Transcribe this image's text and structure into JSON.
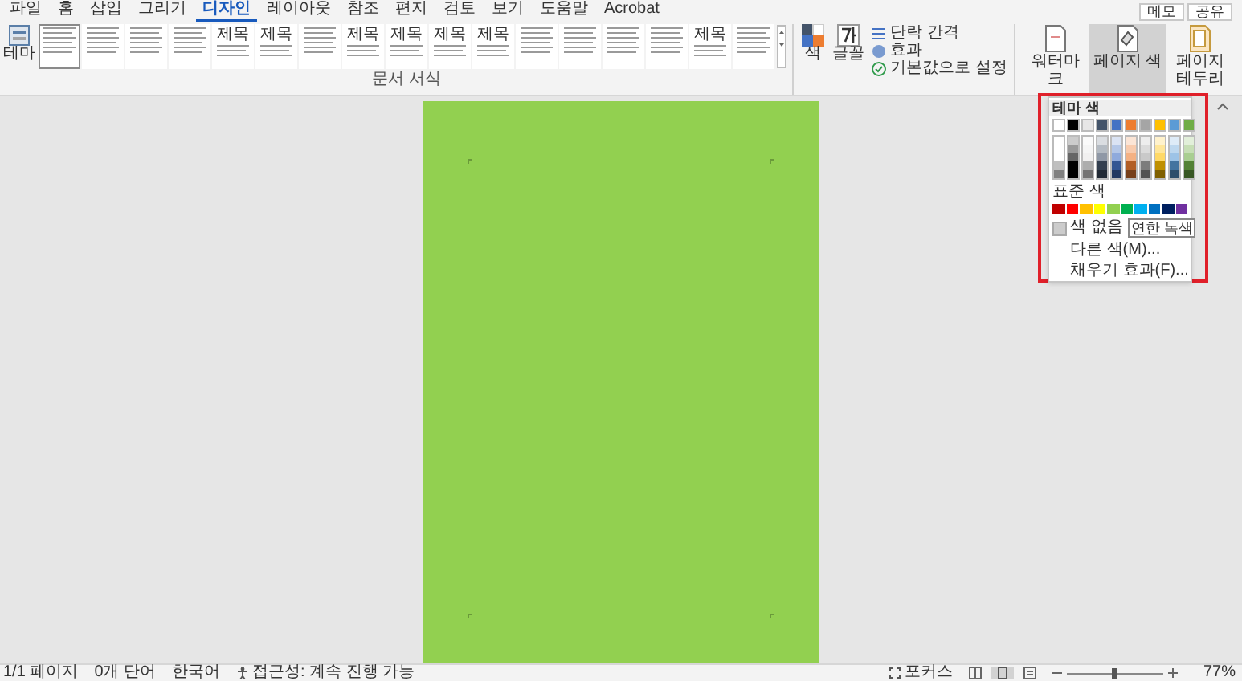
{
  "tabs": [
    {
      "label": "파일",
      "selected": false
    },
    {
      "label": "홈",
      "selected": false
    },
    {
      "label": "삽입",
      "selected": false
    },
    {
      "label": "그리기",
      "selected": false
    },
    {
      "label": "디자인",
      "selected": true
    },
    {
      "label": "레이아웃",
      "selected": false
    },
    {
      "label": "참조",
      "selected": false
    },
    {
      "label": "편지",
      "selected": false
    },
    {
      "label": "검토",
      "selected": false
    },
    {
      "label": "보기",
      "selected": false
    },
    {
      "label": "도움말",
      "selected": false
    },
    {
      "label": "Acrobat",
      "selected": false
    }
  ],
  "top_right": {
    "memo": "메모",
    "share": "공유"
  },
  "ribbon": {
    "theme": "테마",
    "style_gallery": [
      {
        "selected": true
      },
      {
        "selected": false
      },
      {
        "selected": false
      },
      {
        "selected": false
      },
      {
        "title": "제목",
        "selected": false
      },
      {
        "title": "제목",
        "selected": false
      },
      {
        "selected": false
      },
      {
        "title": "제목",
        "selected": false
      },
      {
        "title": "제목",
        "selected": false
      },
      {
        "title": "제목",
        "selected": false
      },
      {
        "title": "제목",
        "selected": false
      },
      {
        "selected": false
      },
      {
        "selected": false
      },
      {
        "selected": false
      },
      {
        "selected": false
      },
      {
        "title": "제목",
        "selected": false
      },
      {
        "selected": false
      }
    ],
    "group_label": "문서 서식",
    "colors": "색",
    "fonts": "글꼴",
    "options": [
      "단락 간격",
      "효과",
      "기본값으로 설정"
    ],
    "page_buttons": [
      {
        "label": "워터마크",
        "selected": false
      },
      {
        "label": "페이지 색",
        "selected": true
      },
      {
        "label": "페이지 테두리",
        "selected": false
      }
    ]
  },
  "color_menu": {
    "header": "테마 색",
    "theme_colors": [
      {
        "color": "#ffffff"
      },
      {
        "color": "#000000"
      },
      {
        "color": "#e7e6e6"
      },
      {
        "color": "#44546a"
      },
      {
        "color": "#4472c4"
      },
      {
        "color": "#ed7d31"
      },
      {
        "color": "#a5a5a5"
      },
      {
        "color": "#ffc000"
      },
      {
        "color": "#5b9bd5"
      },
      {
        "color": "#70ad47"
      }
    ],
    "standard_label": "표준 색",
    "standard_colors": [
      {
        "color": "#c00000"
      },
      {
        "color": "#ff0000"
      },
      {
        "color": "#ffc000"
      },
      {
        "color": "#ffff00"
      },
      {
        "color": "#92d050"
      },
      {
        "color": "#00b050"
      },
      {
        "color": "#00b0f0"
      },
      {
        "color": "#0070c0"
      },
      {
        "color": "#002060"
      },
      {
        "color": "#7030a0"
      }
    ],
    "no_color": "색 없음",
    "tooltip": "연한 녹색",
    "items": [
      "다른 색(M)...",
      "채우기 효과(F)..."
    ]
  },
  "page": {
    "color": "#92d050"
  },
  "status_bar": {
    "left": [
      "1/1 페이지",
      "0개 단어",
      "한국어"
    ],
    "accessibility": "접근성: 계속 진행 가능",
    "focus": "포커스",
    "zoom": {
      "level": 0.5,
      "reading": "77%"
    }
  }
}
